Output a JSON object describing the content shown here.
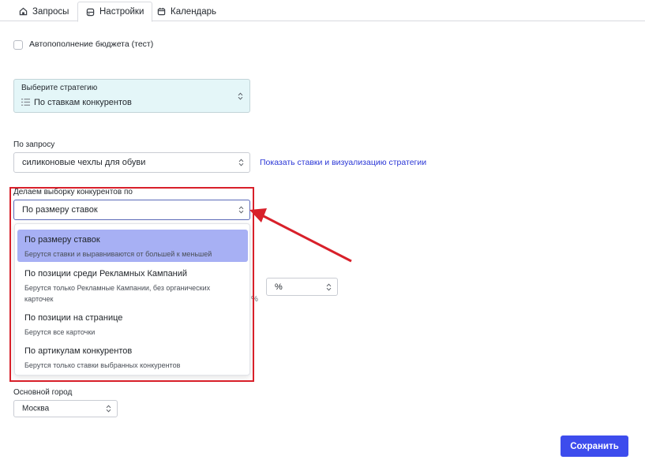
{
  "tabs": [
    {
      "label": "Запросы",
      "icon": "home-icon"
    },
    {
      "label": "Настройки",
      "icon": "settings-icon",
      "active": true
    },
    {
      "label": "Календарь",
      "icon": "calendar-icon"
    }
  ],
  "autofill": {
    "label": "Автопополнение бюджета (тест)",
    "checked": false
  },
  "strategy": {
    "caption": "Выберите стратегию",
    "value": "По ставкам конкурентов"
  },
  "query": {
    "label": "По запросу",
    "value": "силиконовые чехлы для обуви",
    "link": "Показать ставки и визуализацию стратегии"
  },
  "sampling": {
    "label": "Делаем выборку конкурентов по",
    "value": "По размеру ставок",
    "options": [
      {
        "title": "По размеру ставок",
        "desc": "Берутся ставки и выравниваются от большей к меньшей",
        "selected": true
      },
      {
        "title": "По позиции среди Рекламных Кампаний",
        "desc": "Берутся только Рекламные Кампании, без органических карточек"
      },
      {
        "title": "По позиции на странице",
        "desc": "Берутся все карточки"
      },
      {
        "title": "По артикулам конкурентов",
        "desc": "Берутся только ставки выбранных конкурентов"
      }
    ]
  },
  "percent_select": {
    "value": "%"
  },
  "percent_fragment": "%",
  "city": {
    "label": "Основной город",
    "value": "Москва"
  },
  "save_button": "Сохранить",
  "colors": {
    "accent": "#3d4ced",
    "highlight": "#d8202a",
    "selected_option": "#a7b0f4",
    "strategy_bg": "#e4f6f8",
    "link": "#2b37d6"
  }
}
